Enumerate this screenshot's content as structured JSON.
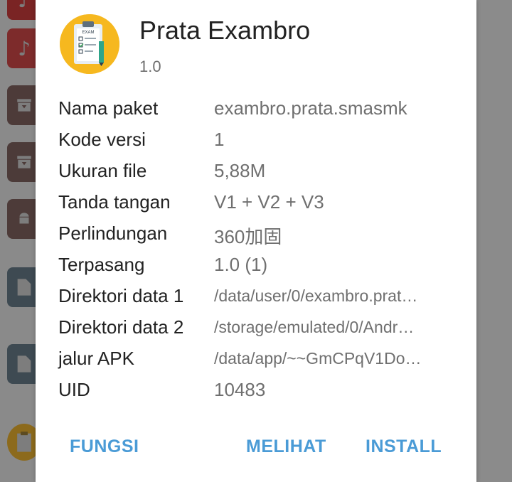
{
  "app": {
    "name": "Prata Exambro",
    "version": "1.0",
    "icon_label": "EXAM",
    "icon": "exam-clipboard-icon"
  },
  "info_rows": [
    {
      "label": "Nama paket",
      "value": "exambro.prata.smasmk"
    },
    {
      "label": "Kode versi",
      "value": "1"
    },
    {
      "label": "Ukuran file",
      "value": "5,88M"
    },
    {
      "label": "Tanda tangan",
      "value": "V1 + V2 + V3"
    },
    {
      "label": "Perlindungan",
      "value": "360加固"
    },
    {
      "label": "Terpasang",
      "value": "1.0 (1)"
    },
    {
      "label": "Direktori data 1",
      "value": "/data/user/0/exambro.prat…"
    },
    {
      "label": "Direktori data 2",
      "value": "/storage/emulated/0/Andr…"
    },
    {
      "label": "jalur APK",
      "value": "/data/app/~~GmCPqV1Do…"
    },
    {
      "label": "UID",
      "value": "10483"
    }
  ],
  "actions": {
    "fungsi": "FUNGSI",
    "melihat": "MELIHAT",
    "install": "INSTALL"
  },
  "colors": {
    "accent": "#4a9bd6",
    "label_text": "#222222",
    "value_text": "#6f6f6f",
    "icon_bg": "#f6b81f"
  }
}
